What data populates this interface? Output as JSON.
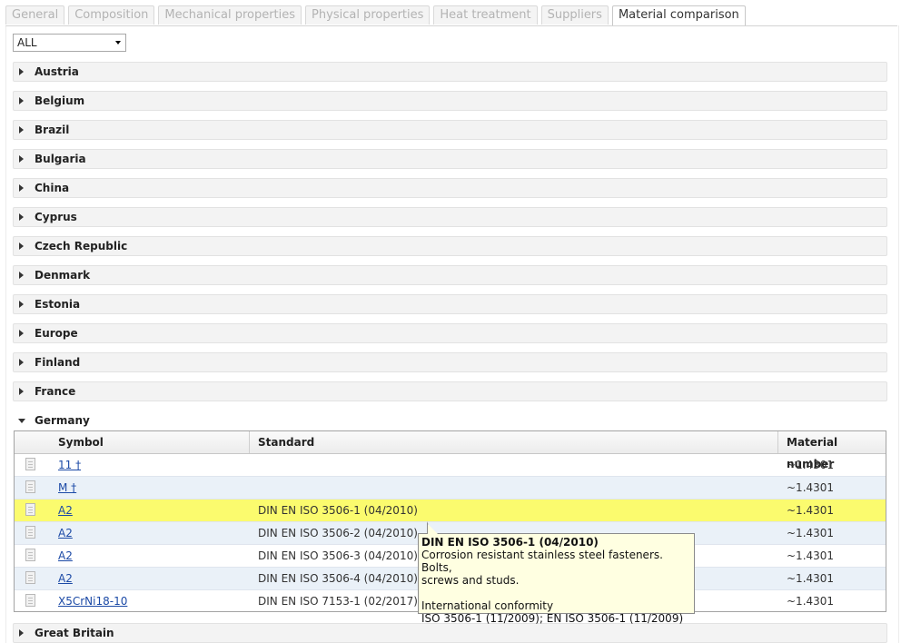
{
  "tabs": [
    {
      "label": "General"
    },
    {
      "label": "Composition"
    },
    {
      "label": "Mechanical properties"
    },
    {
      "label": "Physical properties"
    },
    {
      "label": "Heat treatment"
    },
    {
      "label": "Suppliers"
    },
    {
      "label": "Material comparison"
    }
  ],
  "filter": {
    "selected": "ALL"
  },
  "countries": [
    "Austria",
    "Belgium",
    "Brazil",
    "Bulgaria",
    "China",
    "Cyprus",
    "Czech Republic",
    "Denmark",
    "Estonia",
    "Europe",
    "Finland",
    "France",
    "Germany",
    "Great Britain"
  ],
  "expanded_country": "Germany",
  "table": {
    "headers": {
      "symbol": "Symbol",
      "standard": "Standard",
      "material_number": "Material number"
    },
    "rows": [
      {
        "symbol": "11 †",
        "standard": "",
        "material_number": "~1.4301"
      },
      {
        "symbol": "M †",
        "standard": "",
        "material_number": "~1.4301"
      },
      {
        "symbol": "A2",
        "standard": "DIN EN ISO 3506-1 (04/2010)",
        "material_number": "~1.4301"
      },
      {
        "symbol": "A2",
        "standard": "DIN EN ISO 3506-2 (04/2010)",
        "material_number": "~1.4301"
      },
      {
        "symbol": "A2",
        "standard": "DIN EN ISO 3506-3 (04/2010)",
        "material_number": "~1.4301"
      },
      {
        "symbol": "A2",
        "standard": "DIN EN ISO 3506-4 (04/2010)",
        "material_number": "~1.4301"
      },
      {
        "symbol": "X5CrNi18-10",
        "standard": "DIN EN ISO 7153-1 (02/2017)",
        "material_number": "~1.4301"
      }
    ]
  },
  "tooltip": {
    "title": "DIN EN ISO 3506-1 (04/2010)",
    "line1": "Corrosion resistant stainless steel fasteners. Bolts,",
    "line2": "screws and studs.",
    "line3": "International conformity",
    "line4": "ISO 3506-1 (11/2009); EN ISO 3506-1 (11/2009)"
  },
  "colors": {
    "highlight_row": "#fbfb6e",
    "alt_row": "#eaf1f8",
    "link": "#1c4aa6",
    "tooltip_bg": "#ffffe1"
  }
}
